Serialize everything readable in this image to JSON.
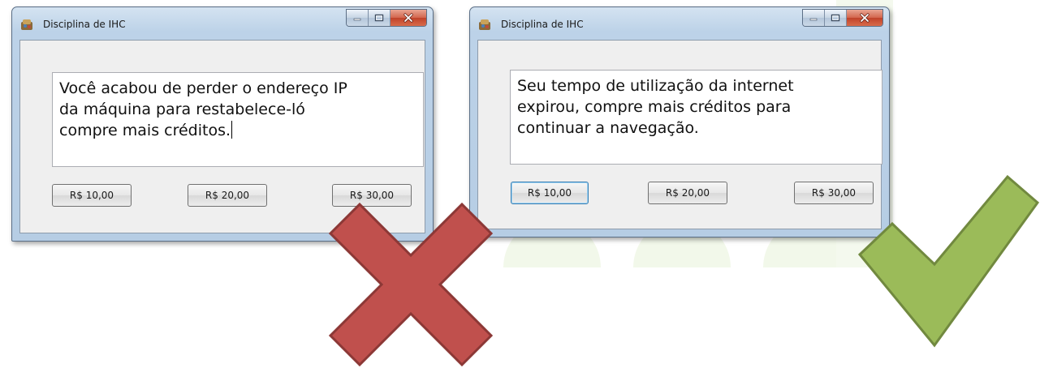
{
  "windows": [
    {
      "title": "Disciplina de IHC",
      "message": "Você acabou de perder o endereço IP\nda máquina para restabelece-ló\ncompre mais créditos.",
      "buttons": [
        "R$ 10,00",
        "R$ 20,00",
        "R$ 30,00"
      ],
      "verdict_icon": "red-x-icon"
    },
    {
      "title": "Disciplina de IHC",
      "message": "Seu tempo de utilização da internet\nexpirou, compre mais créditos para\ncontinuar a navegação.",
      "buttons": [
        "R$ 10,00",
        "R$ 20,00",
        "R$ 30,00"
      ],
      "verdict_icon": "green-check-icon"
    }
  ],
  "colors": {
    "x_mark": "#c0504d",
    "x_outline": "#8c3836",
    "check_mark": "#9bbb59",
    "check_outline": "#71893f",
    "background_deco": "#f2f8ea"
  }
}
